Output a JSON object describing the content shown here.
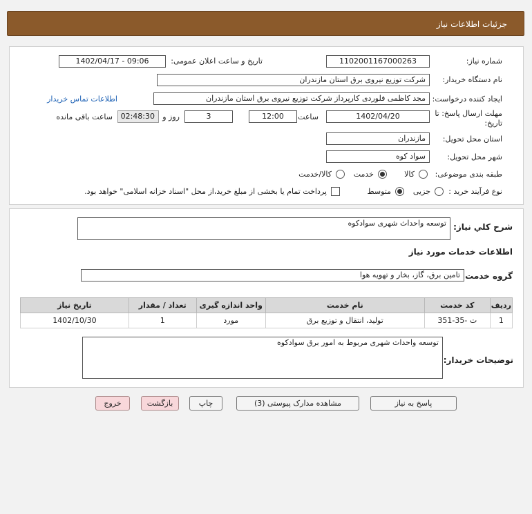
{
  "header": {
    "title": "جزئیات اطلاعات نیاز"
  },
  "info": {
    "need_number_label": "شماره نیاز:",
    "need_number": "1102001167000263",
    "announce_label": "تاریخ و ساعت اعلان عمومی:",
    "announce_value": "1402/04/17 - 09:06",
    "buyer_label": "نام دستگاه خریدار:",
    "buyer_value": "شرکت توزیع نیروی برق استان مازندران",
    "creator_label": "ایجاد کننده درخواست:",
    "creator_value": "مجد کاظمی فلوردی کارپرداز شرکت توزیع نیروی برق استان مازندران",
    "contact_link": "اطلاعات تماس خریدار",
    "deadline_label_1": "مهلت ارسال پاسخ: تا",
    "deadline_label_2": "تاریخ:",
    "deadline_date": "1402/04/20",
    "time_label": "ساعت",
    "deadline_time": "12:00",
    "days_value": "3",
    "days_label": "روز و",
    "remaining_time": "02:48:30",
    "remaining_label": "ساعت باقی مانده",
    "province_label": "استان محل تحویل:",
    "province_value": "مازندران",
    "city_label": "شهر محل تحویل:",
    "city_value": "سواد کوه",
    "category_label": "طبقه بندی موضوعی:",
    "category_options": [
      "کالا",
      "خدمت",
      "کالا/خدمت"
    ],
    "category_selected": 1,
    "process_label": "نوع فرآیند خرید :",
    "process_options": [
      "جزیی",
      "متوسط"
    ],
    "process_selected": 1,
    "payment_note": "پرداخت تمام یا بخشی از مبلغ خرید،از محل \"اسناد خزانه اسلامی\" خواهد بود."
  },
  "details": {
    "general_label": "شرح کلي نياز:",
    "general_value": "توسعه واحداث شهری سوادکوه",
    "services_heading": "اطلاعات خدمات مورد نیاز",
    "group_label": "گروه خدمت:",
    "group_value": "تامین برق، گاز، بخار و تهویه هوا",
    "table": {
      "headers": [
        "ردیف",
        "کد خدمت",
        "نام خدمت",
        "واحد اندازه گیری",
        "تعداد / مقدار",
        "تاریخ نیاز"
      ],
      "rows": [
        [
          "1",
          "ت -35-351",
          "تولید، انتقال و توزیع برق",
          "مورد",
          "1",
          "1402/10/30"
        ]
      ]
    },
    "buyer_desc_label": "توضیحات خریدار:",
    "buyer_desc_value": "توسعه واحداث شهری مربوط به امور برق سوادکوه"
  },
  "buttons": {
    "reply": "پاسخ به نیاز",
    "attachments": "مشاهده مدارک پیوستی (3)",
    "print": "چاپ",
    "back": "بازگشت",
    "exit": "خروج"
  },
  "colors": {
    "header_bg": "#8b5a2b",
    "back_btn_bg": "#f8d7da",
    "exit_btn_bg": "#f8d7da",
    "link": "#1a5fb4"
  }
}
